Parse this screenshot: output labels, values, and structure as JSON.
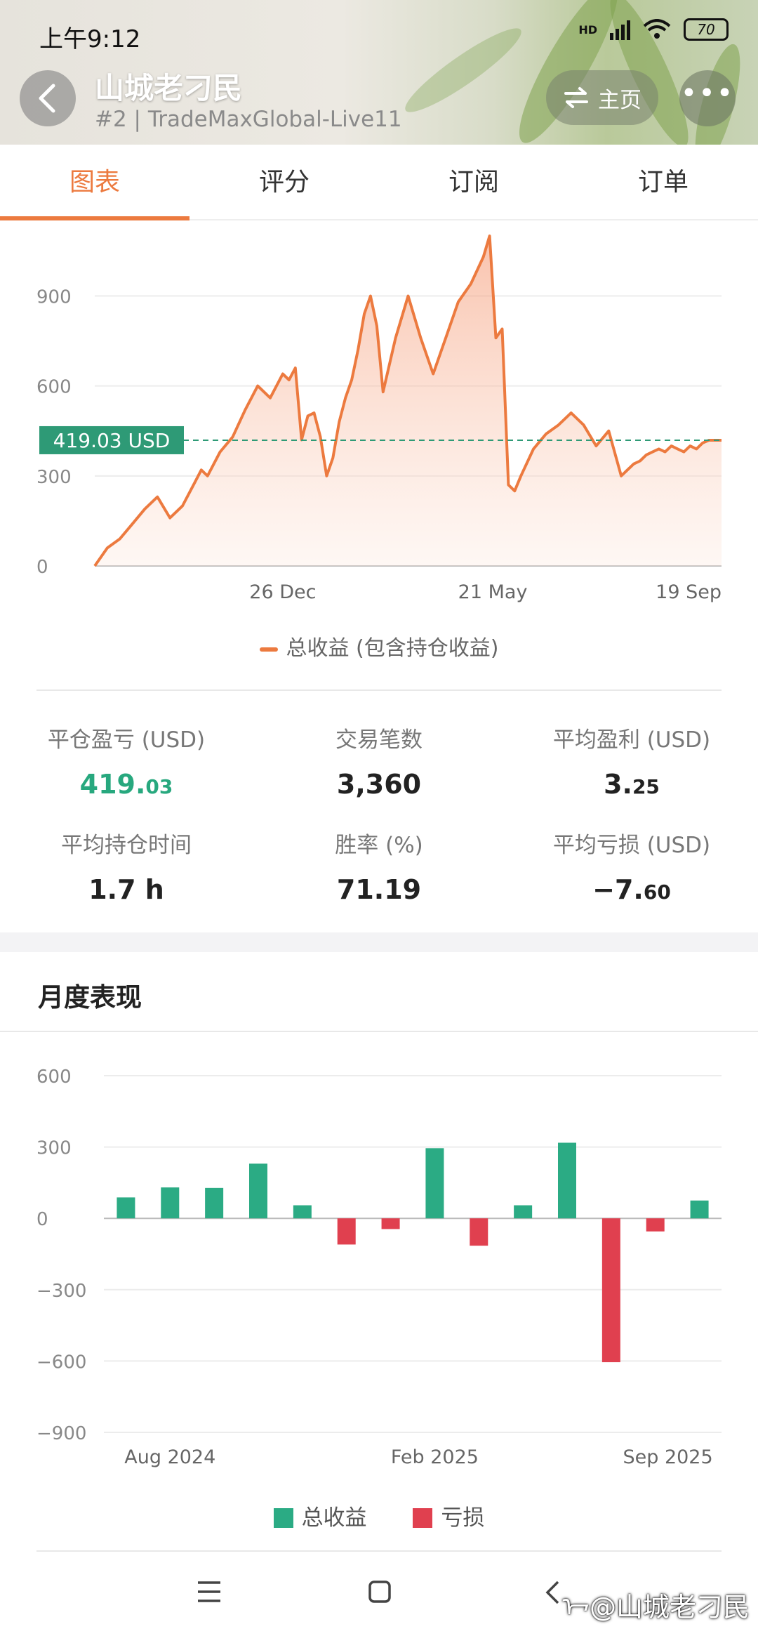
{
  "status_bar": {
    "time": "上午9:12",
    "network": "HD",
    "battery": "70"
  },
  "header": {
    "title": "山城老刁民",
    "subtitle": "#2 | TradeMaxGlobal-Live11",
    "home_label": "主页",
    "more_label": "•••"
  },
  "tabs": [
    {
      "label": "图表",
      "active": true
    },
    {
      "label": "评分",
      "active": false
    },
    {
      "label": "订阅",
      "active": false
    },
    {
      "label": "订单",
      "active": false
    }
  ],
  "chart_data": [
    {
      "type": "area",
      "current_label": "419.03 USD",
      "current_value": 419.03,
      "y_ticks": [
        "900",
        "600",
        "300",
        "0"
      ],
      "x_ticks": [
        "26 Dec",
        "21 May",
        "19 Sep"
      ],
      "ylim": [
        0,
        1100
      ],
      "color": "#ec7a3f",
      "series": [
        {
          "name": "总收益 (包含持仓收益)",
          "x": [
            0,
            2,
            4,
            6,
            8,
            10,
            12,
            14,
            16,
            17,
            18,
            20,
            22,
            24,
            26,
            28,
            30,
            31,
            32,
            33,
            34,
            35,
            36,
            37,
            38,
            39,
            40,
            41,
            42,
            43,
            44,
            45,
            46,
            48,
            50,
            52,
            54,
            56,
            58,
            60,
            62,
            63,
            64,
            65,
            66,
            67,
            68,
            70,
            72,
            74,
            76,
            78,
            80,
            82,
            84,
            86,
            87,
            88,
            89,
            90,
            91,
            92,
            93,
            94,
            95,
            96,
            97,
            98,
            100
          ],
          "values": [
            0,
            60,
            90,
            140,
            190,
            230,
            160,
            200,
            280,
            320,
            300,
            380,
            430,
            520,
            600,
            560,
            640,
            620,
            660,
            420,
            500,
            510,
            430,
            300,
            360,
            480,
            560,
            620,
            720,
            840,
            900,
            800,
            580,
            760,
            900,
            760,
            640,
            760,
            880,
            940,
            1030,
            1100,
            760,
            790,
            270,
            250,
            300,
            390,
            440,
            470,
            510,
            470,
            400,
            450,
            300,
            340,
            350,
            370,
            380,
            390,
            380,
            400,
            390,
            380,
            400,
            390,
            410,
            419.03,
            419.03
          ]
        }
      ]
    },
    {
      "type": "bar",
      "title": "月度表现",
      "y_ticks": [
        "600",
        "300",
        "0",
        "−300",
        "−600",
        "−900"
      ],
      "ylim": [
        -900,
        600
      ],
      "x_ticks": [
        "Aug 2024",
        "Feb 2025",
        "Sep 2025"
      ],
      "categories": [
        "Jul 2024",
        "Aug 2024",
        "Sep 2024",
        "Oct 2024",
        "Nov 2024",
        "Dec 2024",
        "Jan 2025",
        "Feb 2025",
        "Mar 2025",
        "Apr 2025",
        "May 2025",
        "Jun 2025",
        "Jul 2025",
        "Aug 2025"
      ],
      "values": [
        88,
        130,
        128,
        230,
        55,
        -110,
        -45,
        295,
        -115,
        55,
        318,
        -605,
        -55,
        75
      ],
      "series_colors": {
        "gain": "#2bab84",
        "loss": "#e0404f"
      },
      "legend": [
        "总收益",
        "亏损"
      ]
    }
  ],
  "stats": {
    "closed_pl_label": "平仓盈亏 (USD)",
    "closed_pl_int": "419.",
    "closed_pl_dec": "03",
    "trades_label": "交易笔数",
    "trades_value": "3,360",
    "avg_profit_label": "平均盈利 (USD)",
    "avg_profit_int": "3.",
    "avg_profit_dec": "25",
    "avg_hold_label": "平均持仓时间",
    "avg_hold_value": "1.7 h",
    "win_rate_label": "胜率 (%)",
    "win_rate_value": "71.19",
    "avg_loss_label": "平均亏损 (USD)",
    "avg_loss_int": "−7.",
    "avg_loss_dec": "60"
  },
  "section": {
    "monthly_title": "月度表现"
  },
  "navbar": {
    "menu_icon": "menu-icon",
    "home_icon": "square-home-icon",
    "back_icon": "back-icon"
  },
  "watermark": "ᢇ@山城老刁民"
}
